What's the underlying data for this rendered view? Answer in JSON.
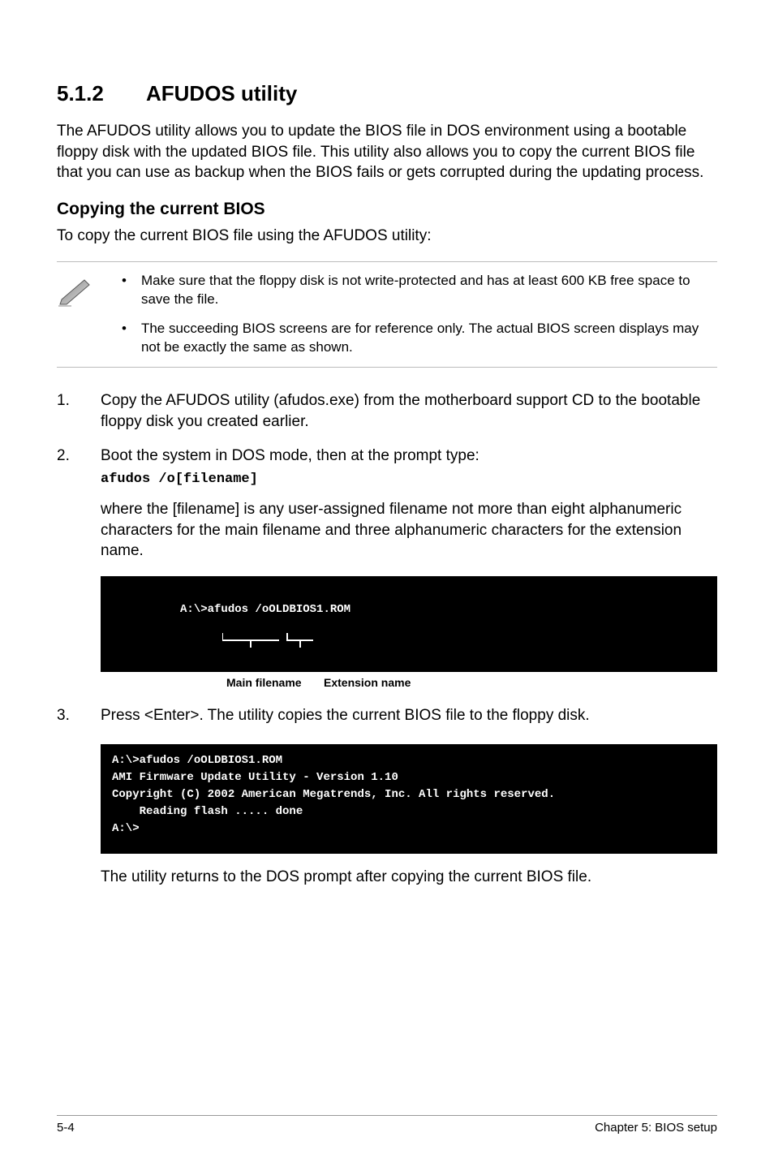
{
  "section": {
    "number": "5.1.2",
    "title": "AFUDOS utility"
  },
  "intro": "The AFUDOS utility allows you to update the BIOS file in DOS environment using a bootable floppy disk with the updated BIOS file. This utility also allows you to copy the current BIOS file that you can use as backup when the BIOS fails or gets corrupted during the updating process.",
  "sub_heading": "Copying the current BIOS",
  "sub_intro": "To copy the current BIOS file using the AFUDOS utility:",
  "notes": [
    "Make sure that the floppy disk is not write-protected and has at least 600 KB free space to save the file.",
    "The succeeding BIOS screens are for reference only. The actual BIOS screen displays may not be exactly the same as shown."
  ],
  "steps": {
    "s1": {
      "num": "1.",
      "text": "Copy the AFUDOS utility (afudos.exe) from the motherboard support CD to the bootable floppy disk you created earlier."
    },
    "s2": {
      "num": "2.",
      "text": "Boot the system in DOS mode, then at the prompt type:",
      "command": "afudos /o[filename]",
      "after": "where the [filename] is any user-assigned filename not more than eight alphanumeric characters  for the main filename and three alphanumeric characters for the extension name."
    },
    "s3": {
      "num": "3.",
      "text": "Press <Enter>. The utility copies the current BIOS file to the floppy disk."
    }
  },
  "code1": "A:\\>afudos /oOLDBIOS1.ROM",
  "labels": {
    "main": "Main filename",
    "ext": "Extension name"
  },
  "code2": "A:\\>afudos /oOLDBIOS1.ROM\nAMI Firmware Update Utility - Version 1.10\nCopyright (C) 2002 American Megatrends, Inc. All rights reserved.\n    Reading flash ..... done\nA:\\>",
  "closing": "The utility returns to the DOS prompt after copying the current BIOS file.",
  "footer": {
    "left": "5-4",
    "right": "Chapter 5: BIOS setup"
  }
}
